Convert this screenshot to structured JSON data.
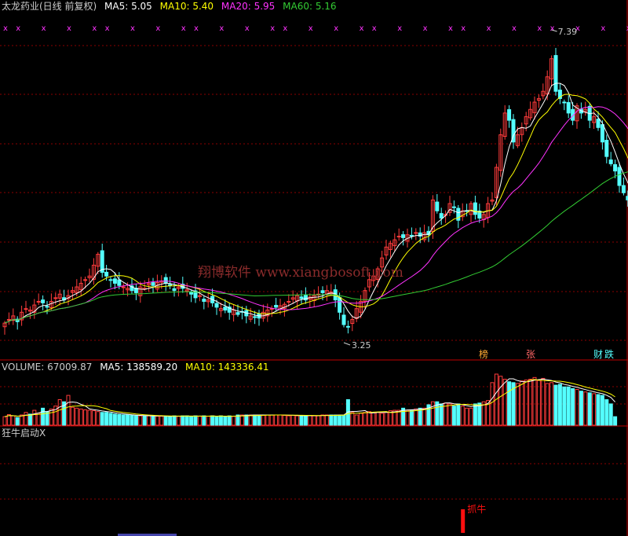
{
  "header": {
    "title": "太龙药业(日线 前复权)",
    "ma5": "MA5: 5.05",
    "ma10": "MA10: 5.40",
    "ma20": "MA20: 5.95",
    "ma60": "MA60: 5.16"
  },
  "volume_header": {
    "volume": "VOLUME: 67009.87",
    "ma5": "MA5: 138589.20",
    "ma10": "MA10: 143336.41"
  },
  "indicator_header": {
    "title": "狂牛启动X"
  },
  "watermark": "翔博软件 www.xiangbosoft.com",
  "annotations": {
    "high_label": "7.39",
    "low_label": "3.25",
    "signal_label": "抓牛",
    "event_tags": [
      "榜",
      "张",
      "财",
      "跌"
    ]
  },
  "colors": {
    "background": "#000000",
    "up": "#ff3b3b",
    "down": "#54ffff",
    "ma5": "#ffffff",
    "ma10": "#ffff00",
    "ma20": "#ff33ff",
    "ma60": "#33cc33",
    "grid": "#8b0000",
    "marker": "#ff33ff",
    "signal": "#ff1010"
  },
  "chart_data": [
    {
      "type": "candlestick",
      "title": "太龙药业(日线 前复权)",
      "ylim": [
        3.0,
        7.6
      ],
      "grid": true,
      "series": [
        {
          "name": "MA5",
          "values": []
        },
        {
          "name": "MA10",
          "values": []
        },
        {
          "name": "MA20",
          "values": []
        },
        {
          "name": "MA60",
          "values": []
        }
      ],
      "close": [
        3.4,
        3.45,
        3.5,
        3.42,
        3.55,
        3.6,
        3.58,
        3.65,
        3.7,
        3.68,
        3.62,
        3.7,
        3.75,
        3.8,
        3.72,
        3.78,
        3.85,
        3.9,
        3.95,
        4.0,
        4.05,
        4.2,
        4.35,
        4.1,
        4.05,
        4.0,
        3.95,
        3.92,
        3.9,
        3.88,
        3.85,
        3.82,
        3.9,
        3.88,
        3.95,
        3.92,
        3.96,
        3.98,
        3.95,
        3.92,
        3.85,
        3.9,
        3.88,
        3.86,
        3.8,
        3.75,
        3.78,
        3.7,
        3.72,
        3.68,
        3.62,
        3.6,
        3.58,
        3.55,
        3.58,
        3.52,
        3.55,
        3.5,
        3.5,
        3.48,
        3.47,
        3.55,
        3.58,
        3.6,
        3.62,
        3.64,
        3.66,
        3.7,
        3.75,
        3.78,
        3.74,
        3.72,
        3.76,
        3.78,
        3.8,
        3.82,
        3.85,
        3.83,
        3.72,
        3.55,
        3.38,
        3.35,
        3.45,
        3.6,
        3.7,
        3.85,
        4.0,
        4.05,
        4.15,
        4.3,
        4.45,
        4.5,
        4.55,
        4.6,
        4.58,
        4.62,
        4.6,
        4.65,
        4.6,
        4.65,
        4.62,
        5.1,
        4.95,
        4.85,
        4.9,
        5.05,
        5.0,
        4.82,
        4.95,
        4.95,
        5.05,
        4.9,
        4.85,
        4.9,
        5.05,
        5.1,
        5.55,
        6.0,
        6.3,
        6.2,
        5.9,
        6.0,
        6.1,
        6.25,
        6.35,
        6.45,
        6.5,
        6.6,
        6.8,
        7.05,
        6.6,
        6.5,
        6.45,
        6.3,
        6.2,
        6.4,
        6.3,
        6.35,
        6.2,
        6.25,
        6.1,
        5.9,
        5.7,
        5.6,
        5.5,
        5.3,
        5.2,
        5.1,
        5.05
      ],
      "volume": [
        20,
        25,
        22,
        18,
        24,
        30,
        26,
        35,
        28,
        40,
        32,
        38,
        45,
        60,
        55,
        70,
        42,
        40,
        38,
        36,
        35,
        34,
        32,
        30,
        30,
        28,
        26,
        25,
        24,
        24,
        23,
        22,
        22,
        22,
        22,
        22,
        21,
        21,
        21,
        20,
        22,
        21,
        22,
        22,
        20,
        22,
        21,
        22,
        21,
        22,
        20,
        22,
        20,
        22,
        21,
        24,
        24,
        24,
        24,
        24,
        24,
        24,
        24,
        24,
        24,
        24,
        23,
        22,
        23,
        22,
        22,
        23,
        23,
        22,
        22,
        24,
        24,
        24,
        24,
        24,
        24,
        60,
        30,
        24,
        28,
        30,
        32,
        30,
        30,
        28,
        30,
        34,
        35,
        35,
        40,
        35,
        36,
        38,
        40,
        40,
        48,
        55,
        55,
        50,
        52,
        50,
        45,
        50,
        45,
        40,
        40,
        50,
        52,
        55,
        58,
        100,
        120,
        115,
        108,
        102,
        100,
        98,
        104,
        106,
        108,
        112,
        105,
        110,
        98,
        100,
        94,
        96,
        90,
        90,
        86,
        84,
        80,
        78,
        76,
        74,
        72,
        70,
        60,
        50,
        20
      ]
    },
    {
      "type": "bar",
      "title": "VOLUME: 67009.87",
      "series": [
        {
          "name": "MA5",
          "values": []
        },
        {
          "name": "MA10",
          "values": []
        }
      ]
    },
    {
      "type": "bar",
      "title": "狂牛启动X",
      "signal_index": 108,
      "signal_label": "抓牛"
    }
  ]
}
